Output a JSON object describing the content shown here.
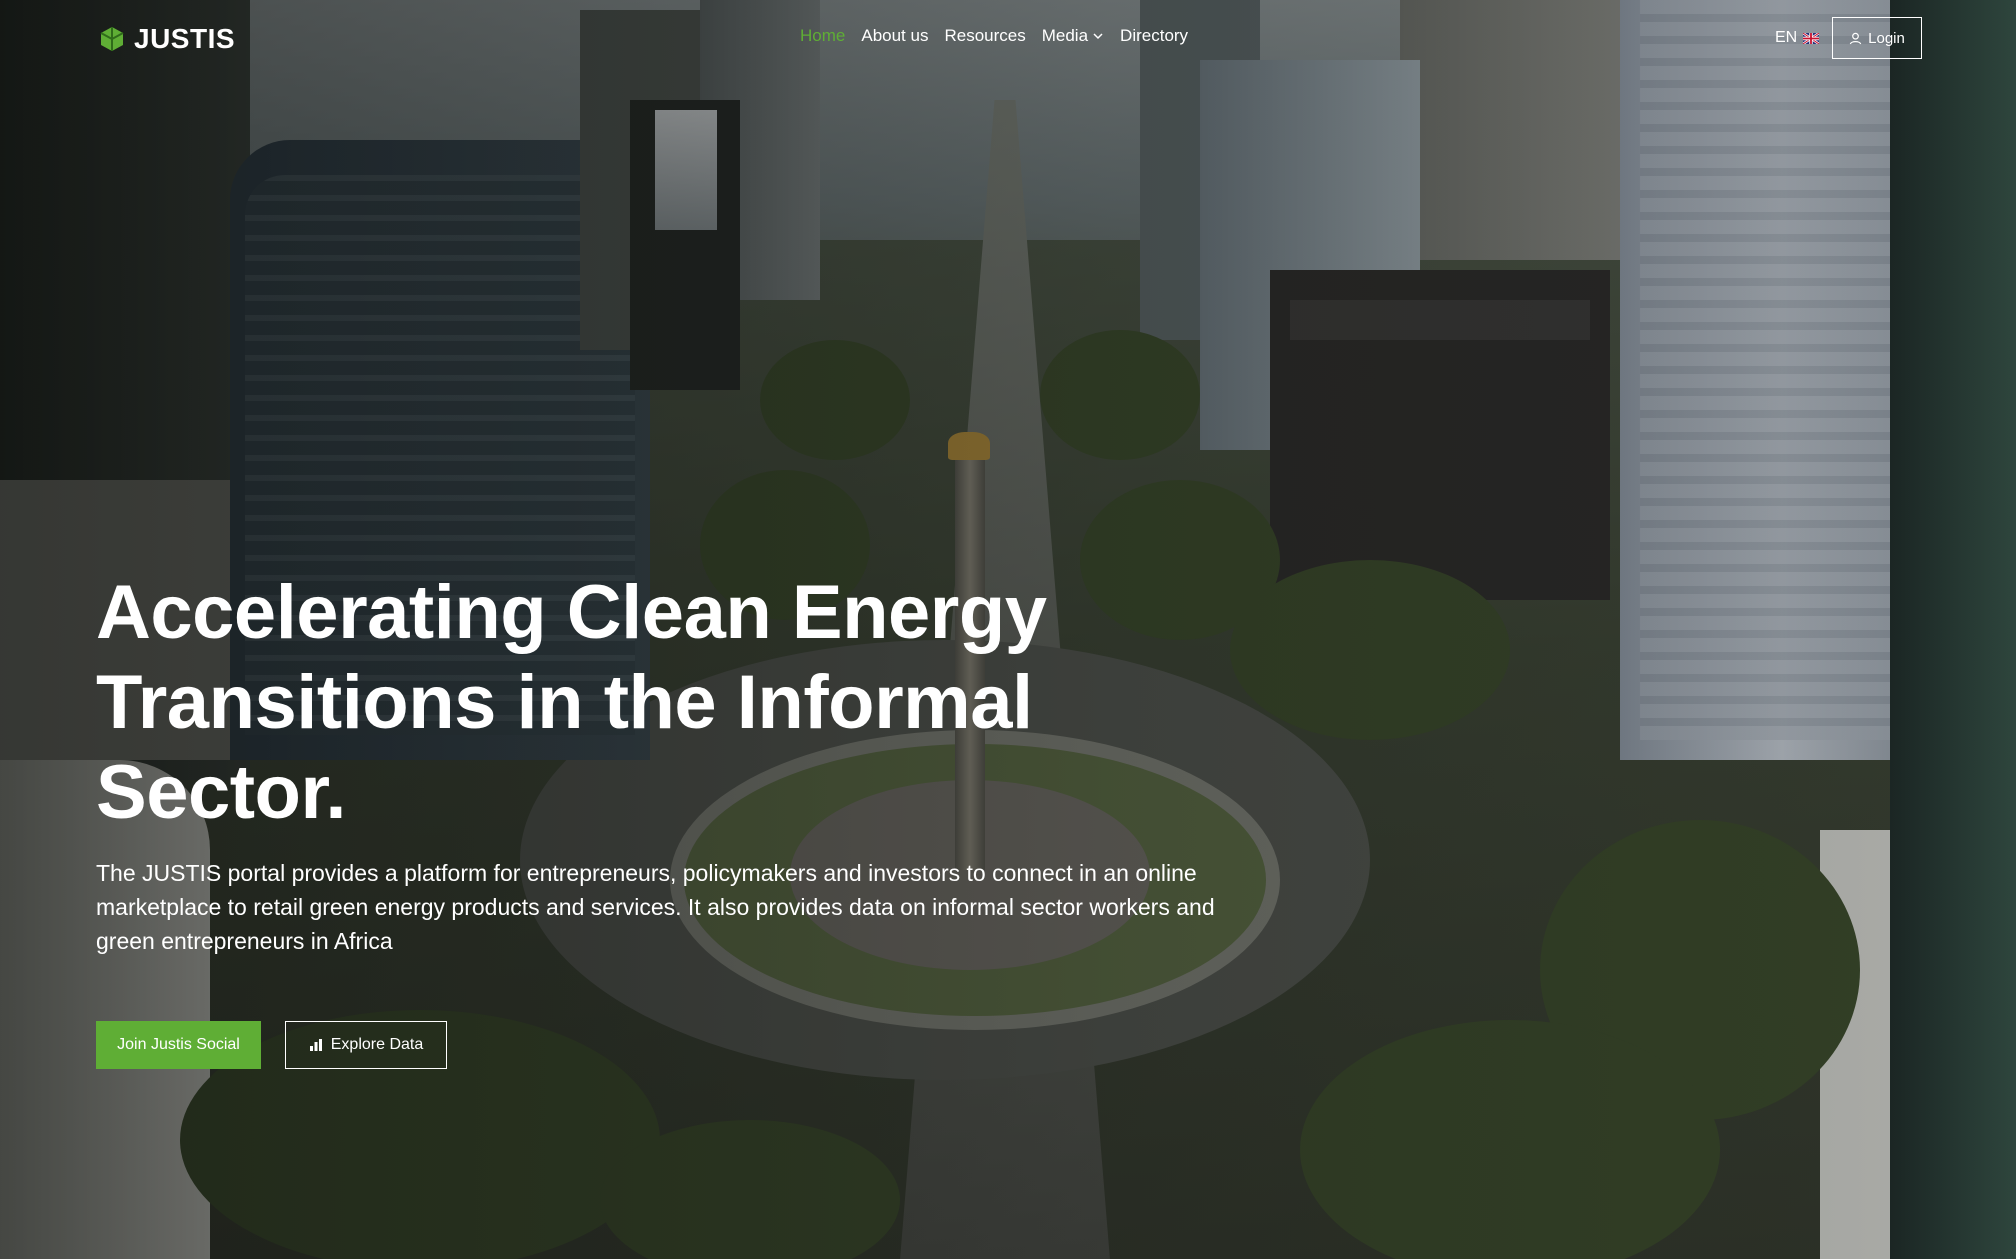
{
  "brand": {
    "name": "JUSTIS",
    "accent_color": "#5fae35"
  },
  "nav": {
    "items": [
      {
        "label": "Home",
        "active": true
      },
      {
        "label": "About us",
        "active": false
      },
      {
        "label": "Resources",
        "active": false
      },
      {
        "label": "Media",
        "active": false,
        "has_dropdown": true
      },
      {
        "label": "Directory",
        "active": false
      }
    ]
  },
  "header": {
    "language": "EN",
    "language_icon": "uk-flag-icon",
    "login_label": "Login",
    "login_icon": "user-icon"
  },
  "hero": {
    "title": "Accelerating Clean Energy Transitions in the Informal Sector.",
    "description": "The JUSTIS portal provides a platform for entrepreneurs, policymakers and investors to connect in an online marketplace to retail green energy products and services. It also provides data on informal sector workers and green entrepreneurs in Africa",
    "primary_button": "Join Justis Social",
    "secondary_button": "Explore Data",
    "secondary_icon": "bar-chart-icon"
  }
}
